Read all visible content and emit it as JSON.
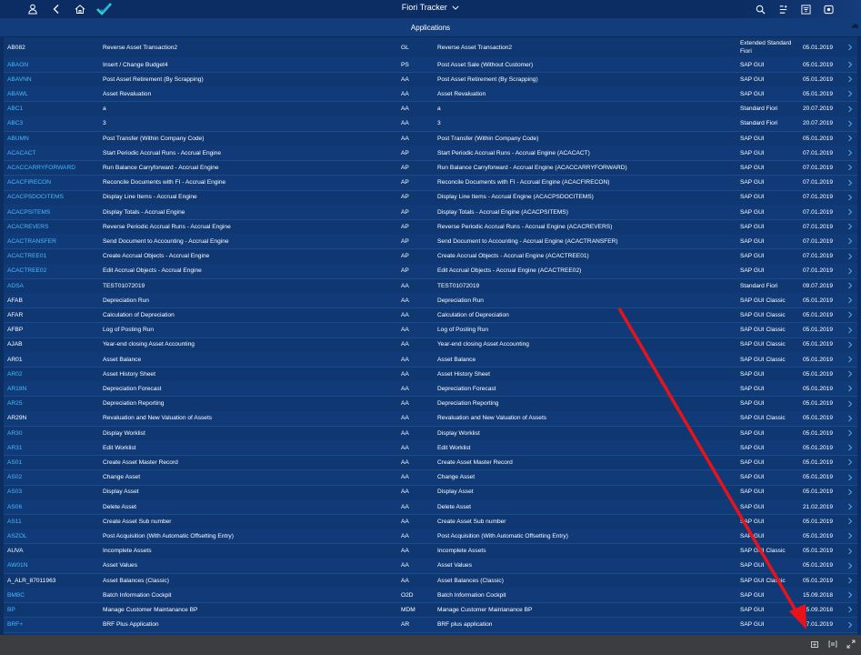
{
  "header": {
    "title": "Fiori Tracker",
    "icons": [
      "user-icon",
      "back-icon",
      "home-icon",
      "logo-checkmark-icon",
      "search-icon",
      "list-icon",
      "filter-icon",
      "notifications-icon"
    ]
  },
  "subheader": {
    "title": "Applications"
  },
  "colors": {
    "link": "#49b9ff",
    "annotation_arrow": "#e8121b",
    "shell": "#0b2d63",
    "footer": "#3b3d41"
  },
  "rows": [
    {
      "code": "AB082",
      "link": false,
      "desc": "Reverse Asset Transaction2",
      "area": "GL",
      "title": "Reverse Asset Transaction2",
      "type": "Extended Standard Fiori",
      "date": "05.01.2019"
    },
    {
      "code": "ABAON",
      "link": true,
      "desc": "Insert / Change Budget4",
      "area": "PS",
      "title": "Post Asset Sale (Without Customer)",
      "type": "SAP GUI",
      "date": "05.01.2019"
    },
    {
      "code": "ABAVNN",
      "link": true,
      "desc": "Post Asset Retirement (By Scrapping)",
      "area": "AA",
      "title": "Post Asset Retirement (By Scrapping)",
      "type": "SAP GUI",
      "date": "05.01.2019"
    },
    {
      "code": "ABAWL",
      "link": true,
      "desc": "Asset Revaluation",
      "area": "AA",
      "title": "Asset Revaluation",
      "type": "SAP GUI",
      "date": "05.01.2019"
    },
    {
      "code": "ABC1",
      "link": true,
      "desc": "a",
      "area": "AA",
      "title": "a",
      "type": "Standard Fiori",
      "date": "20.07.2019"
    },
    {
      "code": "ABC3",
      "link": true,
      "desc": "3",
      "area": "AA",
      "title": "3",
      "type": "Standard Fiori",
      "date": "20.07.2019"
    },
    {
      "code": "ABUMN",
      "link": true,
      "desc": "Post Transfer (Within Company Code)",
      "area": "AA",
      "title": "Post Transfer (Within Company Code)",
      "type": "SAP GUI",
      "date": "05.01.2019"
    },
    {
      "code": "ACACACT",
      "link": true,
      "desc": "Start Periodic Accrual Runs - Accrual Engine",
      "area": "AP",
      "title": "Start Periodic Accrual Runs - Accrual Engine (ACACACT)",
      "type": "SAP GUI",
      "date": "07.01.2019"
    },
    {
      "code": "ACACCARRYFORWARD",
      "link": true,
      "desc": "Run Balance Carryforward - Accrual Engine",
      "area": "AP",
      "title": "Run Balance Carryforward - Accrual Engine (ACACCARRYFORWARD)",
      "type": "SAP GUI",
      "date": "07.01.2019"
    },
    {
      "code": "ACACFIRECON",
      "link": true,
      "desc": "Reconcile Documents with FI - Accrual Engine",
      "area": "AP",
      "title": "Reconcile Documents with FI - Accrual Engine (ACACFIRECON)",
      "type": "SAP GUI",
      "date": "07.01.2019"
    },
    {
      "code": "ACACPSDOCITEMS",
      "link": true,
      "desc": "Display Line Items - Accrual Engine",
      "area": "AP",
      "title": "Display Line Items - Accrual Engine (ACACPSDOCITEMS)",
      "type": "SAP GUI",
      "date": "07.01.2019"
    },
    {
      "code": "ACACPSITEMS",
      "link": true,
      "desc": "Display Totals - Accrual Engine",
      "area": "AP",
      "title": "Display Totals - Accrual Engine (ACACPSITEMS)",
      "type": "SAP GUI",
      "date": "07.01.2019"
    },
    {
      "code": "ACACREVERS",
      "link": true,
      "desc": "Reverse Periodic Accrual Runs - Accrual Engine",
      "area": "AP",
      "title": "Reverse Periodic Accrual Runs - Accrual Engine (ACACREVERS)",
      "type": "SAP GUI",
      "date": "07.01.2019"
    },
    {
      "code": "ACACTRANSFER",
      "link": true,
      "desc": "Send Document to Accounting - Accrual Engine",
      "area": "AP",
      "title": "Send Document to Accounting - Accrual Engine (ACACTRANSFER)",
      "type": "SAP GUI",
      "date": "07.01.2019"
    },
    {
      "code": "ACACTREE01",
      "link": true,
      "desc": "Create Accrual Objects - Accrual Engine",
      "area": "AP",
      "title": "Create Accrual Objects - Accrual Engine (ACACTREE01)",
      "type": "SAP GUI",
      "date": "07.01.2019"
    },
    {
      "code": "ACACTREE02",
      "link": true,
      "desc": "Edit Accrual Objects - Accrual Engine",
      "area": "AP",
      "title": "Edit Accrual Objects - Accrual Engine (ACACTREE02)",
      "type": "SAP GUI",
      "date": "07.01.2019"
    },
    {
      "code": "ADSA",
      "link": true,
      "desc": "TEST01072019",
      "area": "AA",
      "title": "TEST01072019",
      "type": "Standard Fiori",
      "date": "09.07.2019"
    },
    {
      "code": "AFAB",
      "link": false,
      "desc": "Depreciation Run",
      "area": "AA",
      "title": "Depreciation Run",
      "type": "SAP GUI Classic",
      "date": "05.01.2019"
    },
    {
      "code": "AFAR",
      "link": false,
      "desc": "Calculation of Depreciation",
      "area": "AA",
      "title": "Calculation of Depreciation",
      "type": "SAP GUI Classic",
      "date": "05.01.2019"
    },
    {
      "code": "AFBP",
      "link": false,
      "desc": "Log of Posting Run",
      "area": "AA",
      "title": "Log of Posting Run",
      "type": "SAP GUI Classic",
      "date": "05.01.2019"
    },
    {
      "code": "AJAB",
      "link": false,
      "desc": "Year-end closing Asset Accounting",
      "area": "AA",
      "title": "Year-end closing Asset Accounting",
      "type": "SAP GUI Classic",
      "date": "05.01.2019"
    },
    {
      "code": "AR01",
      "link": false,
      "desc": "Asset Balance",
      "area": "AA",
      "title": "Asset Balance",
      "type": "SAP GUI Classic",
      "date": "05.01.2019"
    },
    {
      "code": "AR02",
      "link": true,
      "desc": "Asset History Sheet",
      "area": "AA",
      "title": "Asset History Sheet",
      "type": "SAP GUI",
      "date": "05.01.2019"
    },
    {
      "code": "AR18N",
      "link": true,
      "desc": "Depreciation Forecast",
      "area": "AA",
      "title": "Depreciation Forecast",
      "type": "SAP GUI",
      "date": "05.01.2019"
    },
    {
      "code": "AR25",
      "link": true,
      "desc": "Depreciation Reporting",
      "area": "AA",
      "title": "Depreciation Reporting",
      "type": "SAP GUI",
      "date": "05.01.2019"
    },
    {
      "code": "AR29N",
      "link": false,
      "desc": "Revaluation and New Valuation of Assets",
      "area": "AA",
      "title": "Revaluation and New Valuation of Assets",
      "type": "SAP GUI Classic",
      "date": "05.01.2019"
    },
    {
      "code": "AR30",
      "link": true,
      "desc": "Display Worklist",
      "area": "AA",
      "title": "Display Worklist",
      "type": "SAP GUI",
      "date": "05.01.2019"
    },
    {
      "code": "AR31",
      "link": true,
      "desc": "Edit Worklist",
      "area": "AA",
      "title": "Edit Worklist",
      "type": "SAP GUI",
      "date": "05.01.2019"
    },
    {
      "code": "AS01",
      "link": true,
      "desc": "Create Asset Master Record",
      "area": "AA",
      "title": "Create Asset Master Record",
      "type": "SAP GUI",
      "date": "05.01.2019"
    },
    {
      "code": "AS02",
      "link": true,
      "desc": "Change Asset",
      "area": "AA",
      "title": "Change Asset",
      "type": "SAP GUI",
      "date": "05.01.2019"
    },
    {
      "code": "AS03",
      "link": true,
      "desc": "Display Asset",
      "area": "AA",
      "title": "Display Asset",
      "type": "SAP GUI",
      "date": "05.01.2019"
    },
    {
      "code": "AS06",
      "link": true,
      "desc": "Delete Asset",
      "area": "AA",
      "title": "Delete Asset",
      "type": "SAP GUI",
      "date": "21.02.2019"
    },
    {
      "code": "AS11",
      "link": true,
      "desc": "Create Asset Sub number",
      "area": "AA",
      "title": "Create Asset Sub number",
      "type": "SAP GUI",
      "date": "05.01.2019"
    },
    {
      "code": "ASZOL",
      "link": true,
      "desc": "Post Acquisition (With Automatic Offsetting Entry)",
      "area": "AA",
      "title": "Post Acquisition (With Automatic Offsetting Entry)",
      "type": "SAP GUI",
      "date": "05.01.2019"
    },
    {
      "code": "AUVA",
      "link": false,
      "desc": "Incomplete Assets",
      "area": "AA",
      "title": "Incomplete Assets",
      "type": "SAP GUI Classic",
      "date": "05.01.2019"
    },
    {
      "code": "AW01N",
      "link": true,
      "desc": "Asset Values",
      "area": "AA",
      "title": "Asset Values",
      "type": "SAP GUI",
      "date": "05.01.2019"
    },
    {
      "code": "A_ALR_87011963",
      "link": false,
      "desc": "Asset Balances (Classic)",
      "area": "AA",
      "title": "Asset Balances (Classic)",
      "type": "SAP GUI Classic",
      "date": "05.01.2019"
    },
    {
      "code": "BMBC",
      "link": true,
      "desc": "Batch Information Cockpit",
      "area": "O2D",
      "title": "Batch Information Cockpit",
      "type": "SAP GUI",
      "date": "15.09.2018"
    },
    {
      "code": "BP",
      "link": true,
      "desc": "Manage Customer Maintanance BP",
      "area": "MDM",
      "title": "Manage Customer Maintanance BP",
      "type": "SAP GUI",
      "date": "15.09.2018"
    },
    {
      "code": "BRF+",
      "link": true,
      "desc": "BRF Plus Application",
      "area": "AR",
      "title": "BRF plus application",
      "type": "SAP GUI",
      "date": "07.01.2019"
    }
  ]
}
